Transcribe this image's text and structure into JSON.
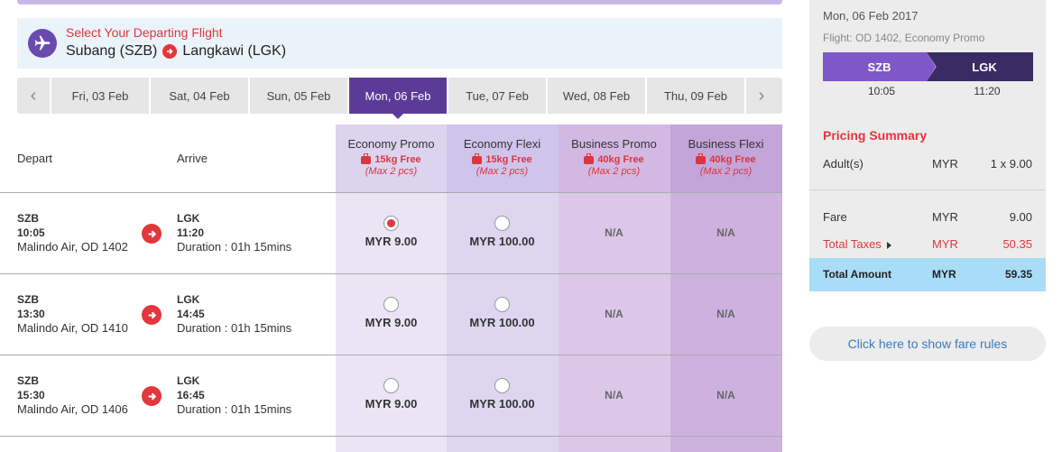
{
  "header": {
    "subtitle": "Select Your Departing Flight",
    "origin": "Subang (SZB)",
    "destination": "Langkawi (LGK)"
  },
  "dates": [
    {
      "label": "Fri, 03 Feb",
      "active": false
    },
    {
      "label": "Sat, 04 Feb",
      "active": false
    },
    {
      "label": "Sun, 05 Feb",
      "active": false
    },
    {
      "label": "Mon, 06 Feb",
      "active": true
    },
    {
      "label": "Tue, 07 Feb",
      "active": false
    },
    {
      "label": "Wed, 08 Feb",
      "active": false
    },
    {
      "label": "Thu, 09 Feb",
      "active": false
    }
  ],
  "table": {
    "depart_header": "Depart",
    "arrive_header": "Arrive",
    "fare_classes": [
      {
        "name": "Economy Promo",
        "baggage": "15kg Free",
        "max": "(Max 2 pcs)",
        "bg": "#eae5f4",
        "header_bg": "#dcd3ee"
      },
      {
        "name": "Economy Flexi",
        "baggage": "15kg Free",
        "max": "(Max 2 pcs)",
        "bg": "#ddd6f1",
        "header_bg": "#cfc4ec"
      },
      {
        "name": "Business Promo",
        "baggage": "40kg Free",
        "max": "(Max 2 pcs)",
        "bg": "#dcc7e8",
        "header_bg": "#d2b9e3"
      },
      {
        "name": "Business Flexi",
        "baggage": "40kg Free",
        "max": "(Max 2 pcs)",
        "bg": "#cdb2df",
        "header_bg": "#c4a5da"
      }
    ],
    "flights": [
      {
        "dep_code": "SZB",
        "dep_time": "10:05",
        "carrier": "Malindo Air, OD 1402",
        "arr_code": "LGK",
        "arr_time": "11:20",
        "duration": "Duration : 01h 15mins",
        "fares": [
          {
            "type": "radio",
            "selected": true,
            "price": "MYR 9.00"
          },
          {
            "type": "radio",
            "selected": false,
            "price": "MYR 100.00"
          },
          {
            "type": "na",
            "text": "N/A"
          },
          {
            "type": "na",
            "text": "N/A"
          }
        ]
      },
      {
        "dep_code": "SZB",
        "dep_time": "13:30",
        "carrier": "Malindo Air, OD 1410",
        "arr_code": "LGK",
        "arr_time": "14:45",
        "duration": "Duration : 01h 15mins",
        "fares": [
          {
            "type": "radio",
            "selected": false,
            "price": "MYR 9.00"
          },
          {
            "type": "radio",
            "selected": false,
            "price": "MYR 100.00"
          },
          {
            "type": "na",
            "text": "N/A"
          },
          {
            "type": "na",
            "text": "N/A"
          }
        ]
      },
      {
        "dep_code": "SZB",
        "dep_time": "15:30",
        "carrier": "Malindo Air, OD 1406",
        "arr_code": "LGK",
        "arr_time": "16:45",
        "duration": "Duration : 01h 15mins",
        "fares": [
          {
            "type": "radio",
            "selected": false,
            "price": "MYR 9.00"
          },
          {
            "type": "radio",
            "selected": false,
            "price": "MYR 100.00"
          },
          {
            "type": "na",
            "text": "N/A"
          },
          {
            "type": "na",
            "text": "N/A"
          }
        ]
      }
    ]
  },
  "summary": {
    "date": "Mon, 06 Feb 2017",
    "flight": "Flight: OD 1402, Economy Promo",
    "from_code": "SZB",
    "to_code": "LGK",
    "from_time": "10:05",
    "to_time": "11:20",
    "pricing_heading": "Pricing Summary",
    "adult": {
      "label": "Adult(s)",
      "currency": "MYR",
      "amount": "1 x 9.00"
    },
    "fare": {
      "label": "Fare",
      "currency": "MYR",
      "amount": "9.00"
    },
    "taxes": {
      "label": "Total Taxes",
      "currency": "MYR",
      "amount": "50.35"
    },
    "total": {
      "label": "Total Amount",
      "currency": "MYR",
      "amount": "59.35"
    },
    "fare_rules_link": "Click here to show fare rules"
  },
  "colors": {
    "accent_purple": "#5b3b97",
    "red": "#e3363d",
    "total_bg": "#a9dcf7",
    "link": "#3a7bbf"
  }
}
